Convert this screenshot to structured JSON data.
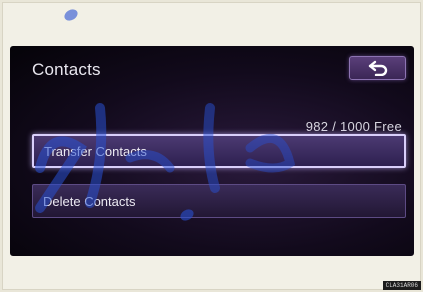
{
  "screen": {
    "title": "Contacts",
    "free_count": "982 / 1000 Free"
  },
  "back_button": {
    "icon": "return-arrow-icon"
  },
  "menu": {
    "items": [
      {
        "label": "Transfer Contacts",
        "selected": true
      },
      {
        "label": "Delete Contacts",
        "selected": false
      }
    ]
  },
  "figure_code": "CLA31AR06",
  "colors": {
    "screen_bg": "#120a1c",
    "button_fill": "#3a2b58",
    "selected_border": "#d9cffa",
    "text": "#eceaf2"
  }
}
